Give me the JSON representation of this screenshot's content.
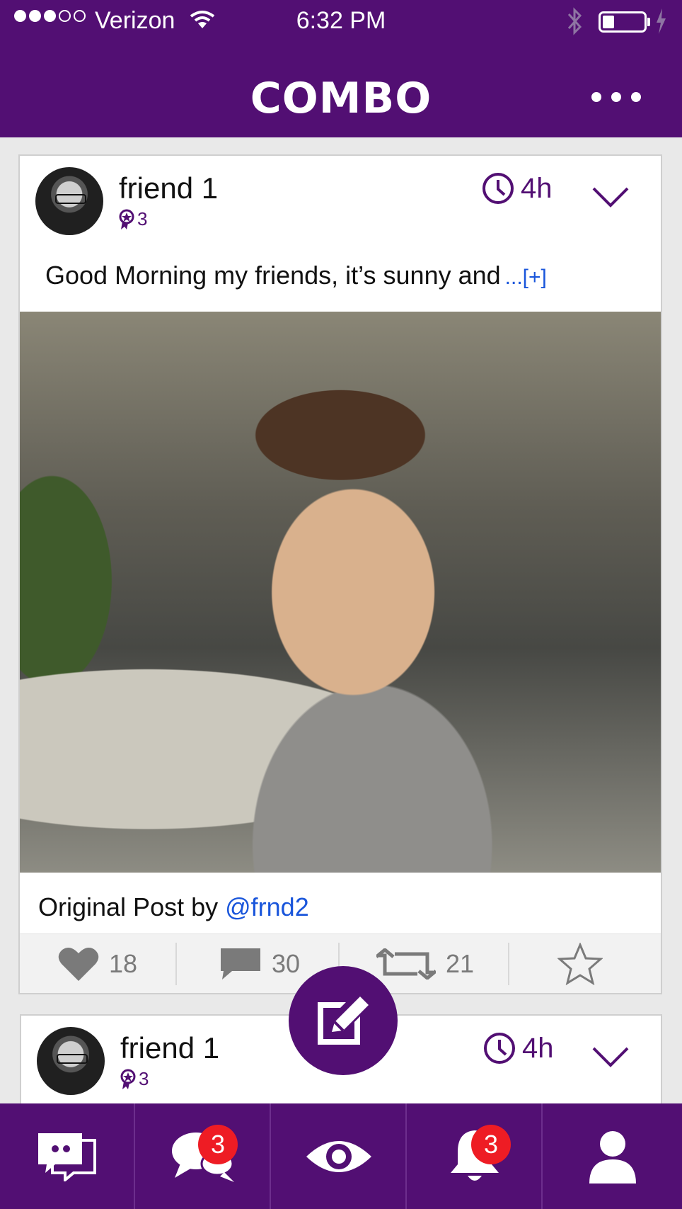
{
  "status_bar": {
    "carrier": "Verizon",
    "time": "6:32 PM"
  },
  "header": {
    "title": "COMBO"
  },
  "posts": [
    {
      "author": "friend 1",
      "badge_count": "3",
      "time_ago": "4h",
      "text": "Good Morning my friends, it’s sunny and",
      "more_label": "...[+]",
      "original_prefix": "Original Post by ",
      "original_author": "@frnd2",
      "likes": "18",
      "comments": "30",
      "reposts": "21"
    },
    {
      "author": "friend 1",
      "badge_count": "3",
      "time_ago": "4h"
    }
  ],
  "bottom_nav": {
    "messages_badge": "3",
    "notifications_badge": "3"
  },
  "colors": {
    "brand": "#520f73",
    "link": "#1a56db",
    "badge": "#ee1c24"
  },
  "icons": [
    "wifi-icon",
    "bluetooth-icon",
    "battery-icon",
    "more-icon",
    "clock-icon",
    "chevron-down-icon",
    "heart-icon",
    "comment-icon",
    "repost-icon",
    "star-icon",
    "compose-icon",
    "chat-icon",
    "messages-icon",
    "eye-icon",
    "bell-icon",
    "user-icon"
  ]
}
